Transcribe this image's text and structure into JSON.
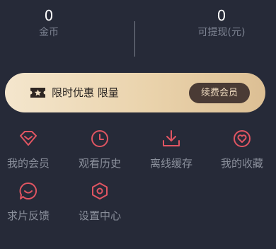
{
  "stats": {
    "coins": {
      "value": "0",
      "label": "金币"
    },
    "withdrawable": {
      "value": "0",
      "label": "可提现(元)"
    }
  },
  "promo": {
    "icon": "ticket-star-icon",
    "text": "限时优惠 限量",
    "button": "续费会员"
  },
  "menu": [
    {
      "label": "我的会员",
      "icon": "diamond-icon"
    },
    {
      "label": "观看历史",
      "icon": "clock-icon"
    },
    {
      "label": "离线缓存",
      "icon": "download-icon"
    },
    {
      "label": "我的收藏",
      "icon": "heart-icon"
    },
    {
      "label": "求片反馈",
      "icon": "chat-bubble-icon"
    },
    {
      "label": "设置中心",
      "icon": "settings-hexagon-icon"
    }
  ],
  "colors": {
    "background": "#262a38",
    "icon_accent": "#e05562",
    "promo_gradient_start": "#f4e6cd",
    "promo_gradient_end": "#dcbf94",
    "button_bg": "#4a3b35"
  }
}
